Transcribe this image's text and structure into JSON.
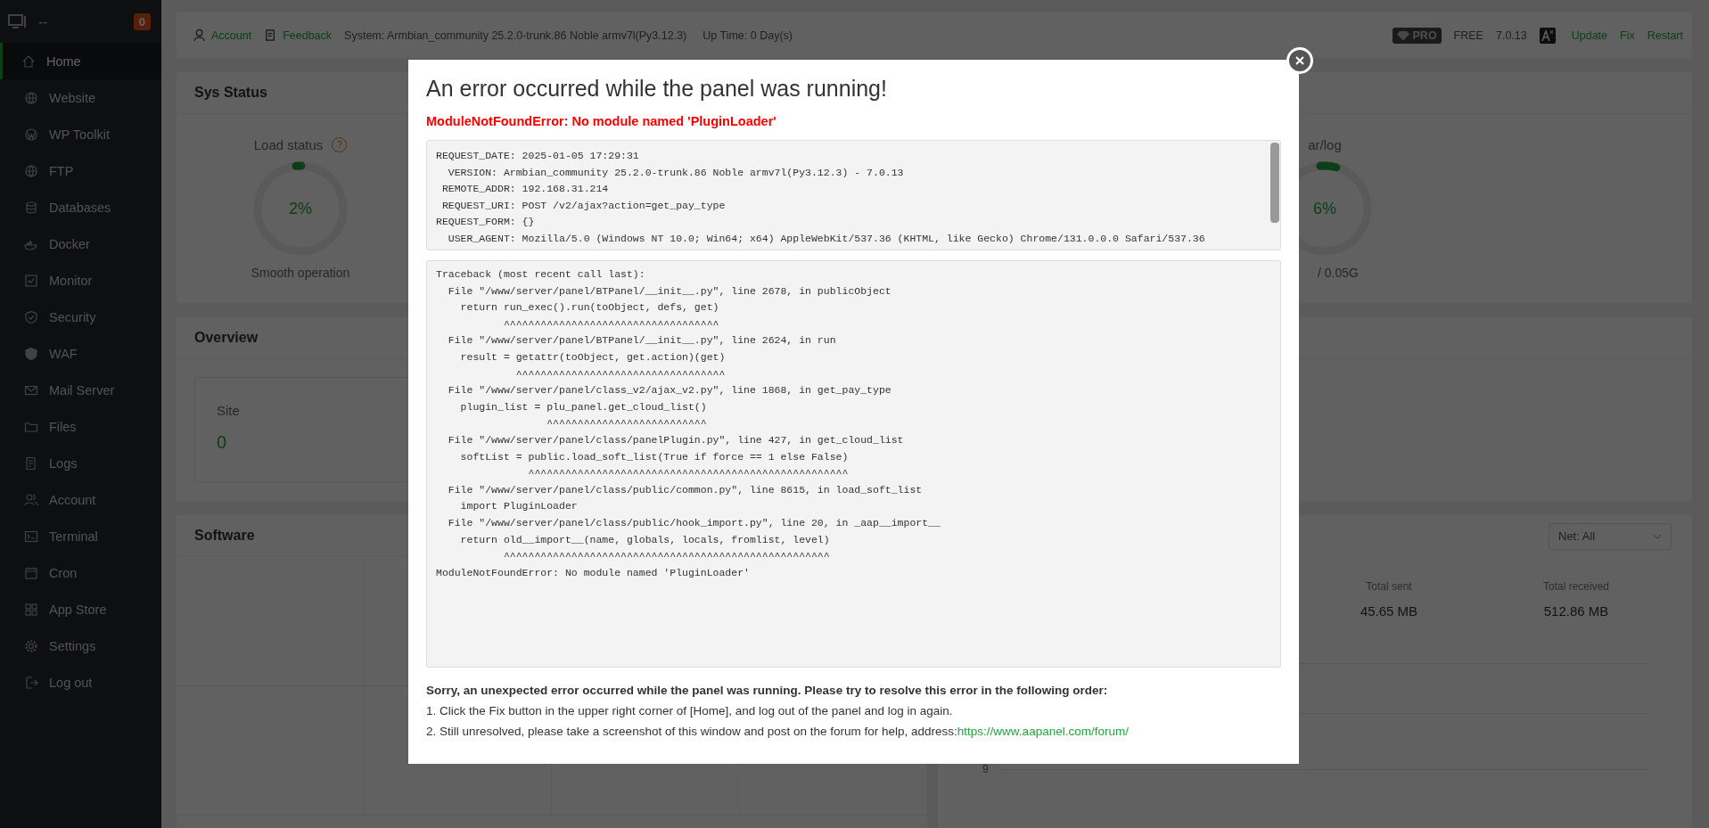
{
  "sidebar": {
    "host": "--",
    "badge": "0",
    "items": [
      {
        "label": "Home",
        "selected": true
      },
      {
        "label": "Website",
        "selected": false
      },
      {
        "label": "WP Toolkit",
        "selected": false
      },
      {
        "label": "FTP",
        "selected": false
      },
      {
        "label": "Databases",
        "selected": false
      },
      {
        "label": "Docker",
        "selected": false
      },
      {
        "label": "Monitor",
        "selected": false
      },
      {
        "label": "Security",
        "selected": false
      },
      {
        "label": "WAF",
        "selected": false
      },
      {
        "label": "Mail Server",
        "selected": false
      },
      {
        "label": "Files",
        "selected": false
      },
      {
        "label": "Logs",
        "selected": false
      },
      {
        "label": "Account",
        "selected": false
      },
      {
        "label": "Terminal",
        "selected": false
      },
      {
        "label": "Cron",
        "selected": false
      },
      {
        "label": "App Store",
        "selected": false
      },
      {
        "label": "Settings",
        "selected": false
      },
      {
        "label": "Log out",
        "selected": false
      }
    ]
  },
  "top_bar": {
    "links": [
      "Account",
      "Feedback"
    ],
    "system": "System: Armbian_community 25.2.0-trunk.86 Noble armv7l(Py3.12.3)",
    "uptime": "Up Time: 0 Day(s)",
    "pro_badge": "PRO",
    "plan": "FREE",
    "version": "7.0.13",
    "actions": [
      "Update",
      "Fix",
      "Restart"
    ]
  },
  "sys_status": {
    "title": "Sys Status",
    "gauges": [
      {
        "title": "Load status",
        "help": "?",
        "value": "2%",
        "level": 0.02,
        "footer": "Smooth operation"
      },
      {
        "title": "ar/log",
        "value": "6%",
        "level": 0.06,
        "footer": "/ 0.05G"
      }
    ]
  },
  "overview": {
    "title": "Overview",
    "cards": [
      {
        "label": "Site",
        "value": "0"
      }
    ]
  },
  "software": {
    "title": "Software"
  },
  "traffic": {
    "filter": "Net: All",
    "stats": [
      {
        "label": "Total sent",
        "value": "45.65 MB"
      },
      {
        "label": "Total received",
        "value": "512.86 MB"
      }
    ],
    "axis_label": "9"
  },
  "modal": {
    "title": "An error occurred while the panel was running!",
    "error": "ModuleNotFoundError: No module named 'PluginLoader'",
    "request_lines": [
      "REQUEST_DATE: 2025-01-05 17:29:31",
      "  VERSION: Armbian_community 25.2.0-trunk.86 Noble armv7l(Py3.12.3) - 7.0.13",
      " REMOTE_ADDR: 192.168.31.214",
      " REQUEST_URI: POST /v2/ajax?action=get_pay_type",
      "REQUEST_FORM: {}",
      "  USER_AGENT: Mozilla/5.0 (Windows NT 10.0; Win64; x64) AppleWebKit/537.36 (KHTML, like Gecko) Chrome/131.0.0.0 Safari/537.36"
    ],
    "traceback_lines": [
      "Traceback (most recent call last):",
      "  File \"/www/server/panel/BTPanel/__init__.py\", line 2678, in publicObject",
      "    return run_exec().run(toObject, defs, get)",
      "           ^^^^^^^^^^^^^^^^^^^^^^^^^^^^^^^^^^^",
      "  File \"/www/server/panel/BTPanel/__init__.py\", line 2624, in run",
      "    result = getattr(toObject, get.action)(get)",
      "             ^^^^^^^^^^^^^^^^^^^^^^^^^^^^^^^^^^",
      "  File \"/www/server/panel/class_v2/ajax_v2.py\", line 1868, in get_pay_type",
      "    plugin_list = plu_panel.get_cloud_list()",
      "                  ^^^^^^^^^^^^^^^^^^^^^^^^^^",
      "  File \"/www/server/panel/class/panelPlugin.py\", line 427, in get_cloud_list",
      "    softList = public.load_soft_list(True if force == 1 else False)",
      "               ^^^^^^^^^^^^^^^^^^^^^^^^^^^^^^^^^^^^^^^^^^^^^^^^^^^^",
      "  File \"/www/server/panel/class/public/common.py\", line 8615, in load_soft_list",
      "    import PluginLoader",
      "  File \"/www/server/panel/class/public/hook_import.py\", line 20, in _aap__import__",
      "    return old__import__(name, globals, locals, fromlist, level)",
      "           ^^^^^^^^^^^^^^^^^^^^^^^^^^^^^^^^^^^^^^^^^^^^^^^^^^^^^",
      "ModuleNotFoundError: No module named 'PluginLoader'"
    ],
    "help_heading": "Sorry, an unexpected error occurred while the panel was running. Please try to resolve this error in the following order:",
    "steps": [
      {
        "text": "1. Click the Fix button in the upper right corner of [Home], and log out of the panel and log in again."
      },
      {
        "text": "2. Still unresolved, please take a screenshot of this window and post on the forum for help, address:",
        "link": "https://www.aapanel.com/forum/"
      }
    ]
  }
}
